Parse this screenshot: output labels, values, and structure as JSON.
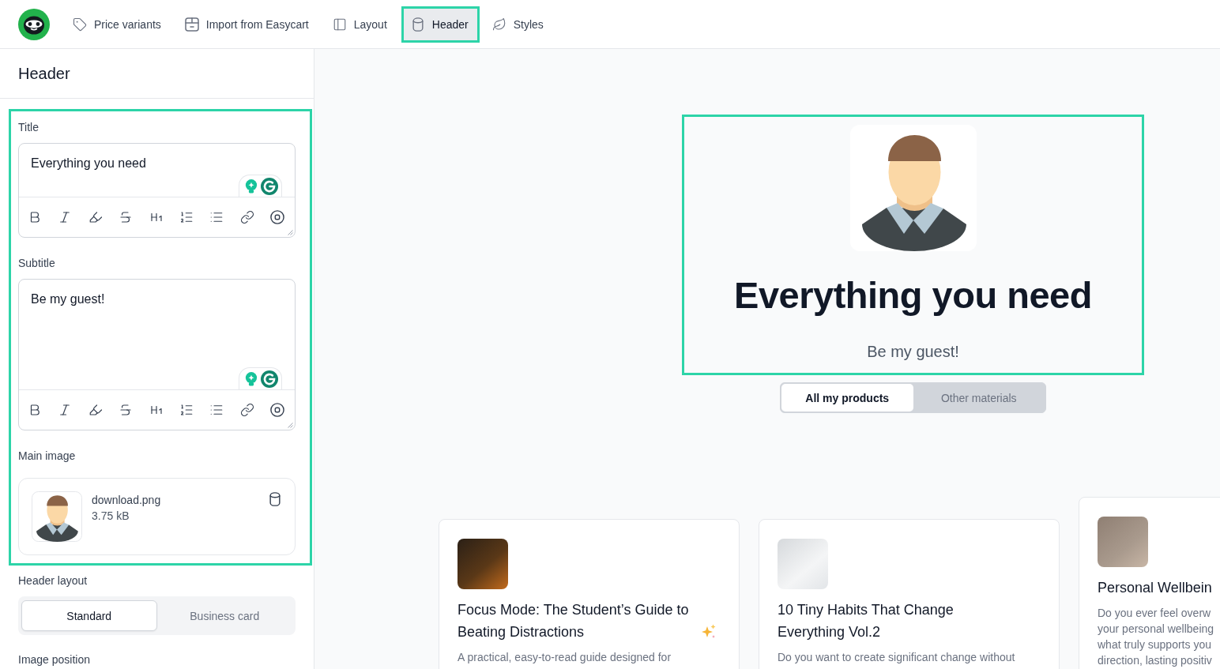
{
  "nav": {
    "tabs": [
      {
        "label": "Price variants",
        "selected": false
      },
      {
        "label": "Import from Easycart",
        "selected": false
      },
      {
        "label": "Layout",
        "selected": false
      },
      {
        "label": "Header",
        "selected": true
      },
      {
        "label": "Styles",
        "selected": false
      }
    ]
  },
  "sidebar": {
    "title": "Header",
    "fields": [
      {
        "kind": "rich_text",
        "label": "Title",
        "value": "Everything you need"
      },
      {
        "kind": "rich_text",
        "label": "Subtitle",
        "value": "Be my guest!"
      },
      {
        "kind": "image",
        "label": "Main image",
        "file_name": "download.png",
        "file_size": "3.75 kB"
      }
    ],
    "header_layout": {
      "label": "Header layout",
      "options": [
        {
          "label": "Standard",
          "selected": true
        },
        {
          "label": "Business card",
          "selected": false
        }
      ]
    },
    "image_position": {
      "label": "Image position"
    }
  },
  "preview": {
    "title": "Everything you need",
    "subtitle": "Be my guest!",
    "tabs": [
      {
        "label": "All my products",
        "selected": true
      },
      {
        "label": "Other materials",
        "selected": false
      }
    ],
    "products": [
      {
        "title": "Focus Mode: The Student’s Guide to Beating Distractions",
        "sparkle": true,
        "description_lines": [
          "A practical, easy-to-read guide designed for"
        ]
      },
      {
        "title": "10 Tiny Habits That Change Everything Vol.2",
        "sparkle": false,
        "description_lines": [
          "Do you want to create significant change without"
        ]
      },
      {
        "title": "Personal Wellbein",
        "sparkle": false,
        "description_lines": [
          "Do you ever feel overw",
          "your personal wellbeing",
          "what truly supports you",
          "direction, lasting positiv"
        ]
      }
    ]
  }
}
